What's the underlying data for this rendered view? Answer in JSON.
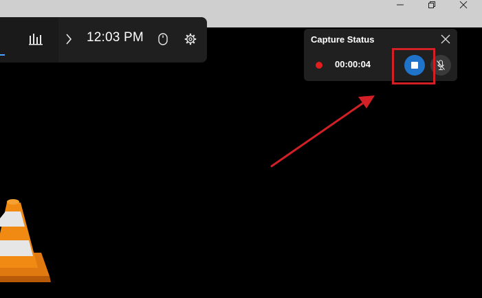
{
  "game_bar": {
    "time": "12:03 PM",
    "icons": [
      "performance-icon",
      "chevron-right-icon",
      "mouse-icon",
      "gear-icon"
    ]
  },
  "capture_status": {
    "title": "Capture Status",
    "elapsed": "00:00:04",
    "icons": [
      "close-icon",
      "recording-dot-icon",
      "stop-icon",
      "mic-muted-icon"
    ],
    "colors": {
      "record_dot": "#e11d1d",
      "stop_button": "#1f73c8",
      "highlight": "#d32026"
    }
  },
  "window_controls": [
    "minimize-icon",
    "restore-icon",
    "close-icon"
  ],
  "annotations": {
    "arrow_color": "#d32026"
  }
}
